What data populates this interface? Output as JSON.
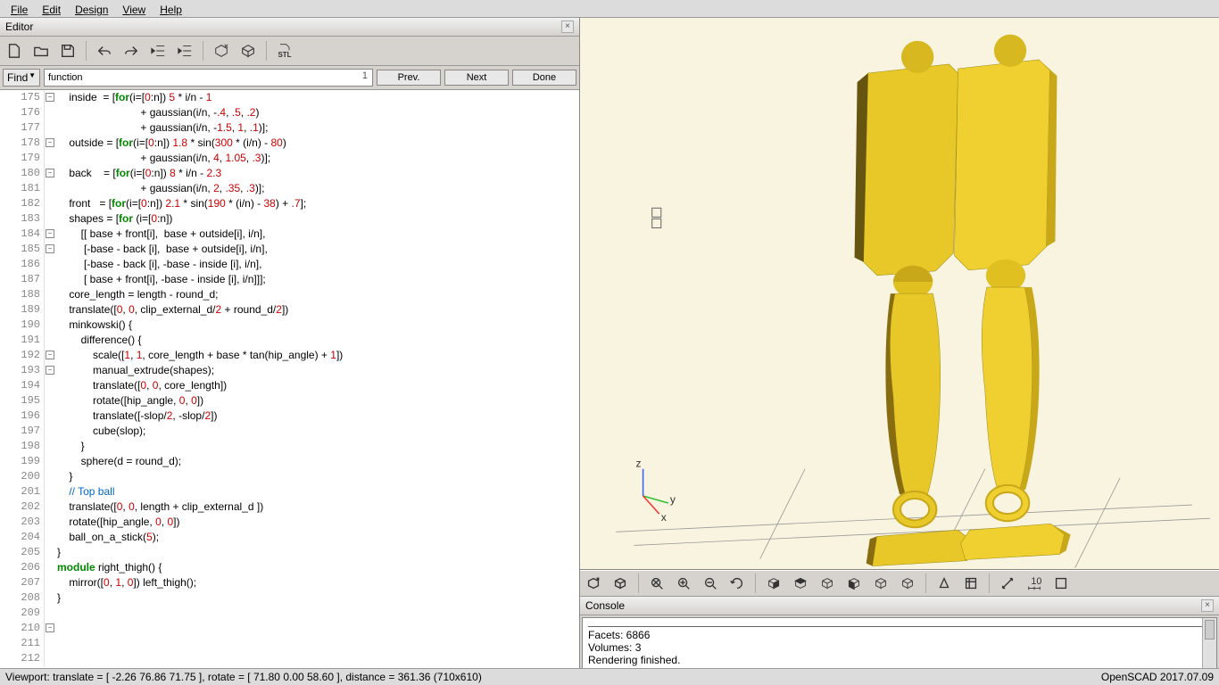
{
  "menu": {
    "file": "File",
    "edit": "Edit",
    "design": "Design",
    "view": "View",
    "help": "Help"
  },
  "editor": {
    "title": "Editor",
    "find_label": "Find",
    "find_value": "function",
    "find_count": "1",
    "prev": "Prev.",
    "next": "Next",
    "done": "Done",
    "lines": [
      {
        "n": 175,
        "fold": "-",
        "t": "    inside  = [<k>for</k>(i=[<n>0</n>:n]) <n>5</n> * i/n - <n>1</n>"
      },
      {
        "n": 176,
        "t": "                            + gaussian(i/n, -<n>.4</n>, <n>.5</n>, <n>.2</n>)"
      },
      {
        "n": 177,
        "t": "                            + gaussian(i/n, -<n>1.5</n>, <n>1</n>, <n>.1</n>)];"
      },
      {
        "n": 178,
        "fold": "-",
        "t": "    outside = [<k>for</k>(i=[<n>0</n>:n]) <n>1.8</n> * <f>sin</f>(<n>300</n> * (i/n) - <n>80</n>)"
      },
      {
        "n": 179,
        "t": "                            + gaussian(i/n, <n>4</n>, <n>1.05</n>, <n>.3</n>)];"
      },
      {
        "n": 180,
        "fold": "-",
        "t": "    back    = [<k>for</k>(i=[<n>0</n>:n]) <n>8</n> * i/n - <n>2.3</n>"
      },
      {
        "n": 181,
        "t": "                            + gaussian(i/n, <n>2</n>, <n>.35</n>, <n>.3</n>)];"
      },
      {
        "n": 182,
        "t": "    front   = [<k>for</k>(i=[<n>0</n>:n]) <n>2.1</n> * <f>sin</f>(<n>190</n> * (i/n) - <n>38</n>) + <n>.7</n>];"
      },
      {
        "n": 183,
        "t": ""
      },
      {
        "n": 184,
        "fold": "-",
        "t": "    shapes = [<k>for</k> (i=[<n>0</n>:n])"
      },
      {
        "n": 185,
        "fold": "-",
        "t": "        [[ base + front[i],  base + outside[i], i/n],"
      },
      {
        "n": 186,
        "t": "         [-base - back [i],  base + outside[i], i/n],"
      },
      {
        "n": 187,
        "t": "         [-base - back [i], -base - inside [i], i/n],"
      },
      {
        "n": 188,
        "t": "         [ base + front[i], -base - inside [i], i/n]]];"
      },
      {
        "n": 189,
        "t": ""
      },
      {
        "n": 190,
        "t": "    core_length = length - round_d;"
      },
      {
        "n": 191,
        "t": "    <f>translate</f>([<n>0</n>, <n>0</n>, clip_external_d/<n>2</n> + round_d/<n>2</n>])"
      },
      {
        "n": 192,
        "fold": "-",
        "t": "    <f>minkowski</f>() {"
      },
      {
        "n": 193,
        "fold": "-",
        "t": "        <f>difference</f>() {"
      },
      {
        "n": 194,
        "t": "            <f>scale</f>([<n>1</n>, <n>1</n>, core_length + base * <f>tan</f>(hip_angle) + <n>1</n>])"
      },
      {
        "n": 195,
        "t": "            manual_extrude(shapes);"
      },
      {
        "n": 196,
        "t": "            <f>translate</f>([<n>0</n>, <n>0</n>, core_length])"
      },
      {
        "n": 197,
        "t": "            <f>rotate</f>([hip_angle, <n>0</n>, <n>0</n>])"
      },
      {
        "n": 198,
        "t": "            <f>translate</f>([-slop/<n>2</n>, -slop/<n>2</n>])"
      },
      {
        "n": 199,
        "t": "            <f>cube</f>(slop);"
      },
      {
        "n": 200,
        "t": "        }"
      },
      {
        "n": 201,
        "t": "        <f>sphere</f>(d = round_d);"
      },
      {
        "n": 202,
        "t": "    }"
      },
      {
        "n": 203,
        "t": ""
      },
      {
        "n": 204,
        "t": "    <c>// Top ball</c>"
      },
      {
        "n": 205,
        "t": "    <f>translate</f>([<n>0</n>, <n>0</n>, length + clip_external_d ])"
      },
      {
        "n": 206,
        "t": "    <f>rotate</f>([hip_angle, <n>0</n>, <n>0</n>])"
      },
      {
        "n": 207,
        "t": "    ball_on_a_stick(<n>5</n>);"
      },
      {
        "n": 208,
        "t": "}"
      },
      {
        "n": 209,
        "t": ""
      },
      {
        "n": 210,
        "fold": "-",
        "t": "<k>module</k> right_thigh() {"
      },
      {
        "n": 211,
        "t": "    <f>mirror</f>([<n>0</n>, <n>1</n>, <n>0</n>]) left_thigh();"
      },
      {
        "n": 212,
        "t": "}"
      }
    ]
  },
  "console": {
    "title": "Console",
    "lines": [
      "         Facets:       6866",
      "       Volumes:          3",
      "Rendering finished."
    ]
  },
  "status": {
    "left": "Viewport: translate = [ -2.26 76.86 71.75 ], rotate = [ 71.80 0.00 58.60 ], distance = 361.36 (710x610)",
    "right": "OpenSCAD 2017.07.09"
  },
  "axes": {
    "x": "x",
    "y": "y",
    "z": "z"
  }
}
